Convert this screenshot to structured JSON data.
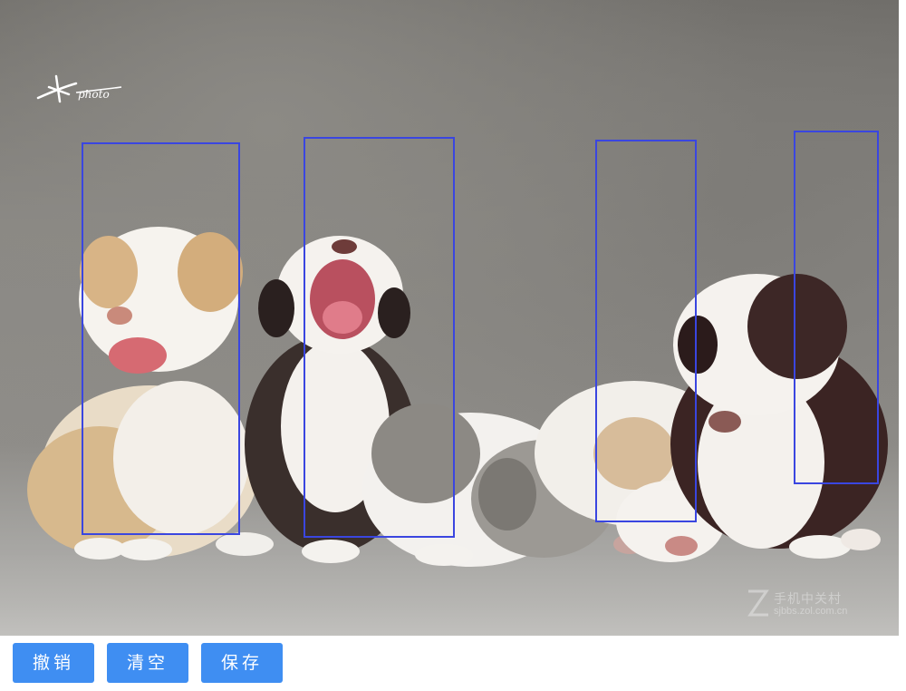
{
  "image": {
    "description_icon": "puppies-photo",
    "signature_icon": "photo-signature-logo",
    "watermark": {
      "line1": "手机中关村",
      "line2": "sjbbs.zol.com.cn"
    }
  },
  "annotations": {
    "box_color": "#3a46e0",
    "count": 4
  },
  "toolbar": {
    "undo_label": "撤销",
    "clear_label": "清空",
    "save_label": "保存",
    "button_color": "#3f8ef2"
  }
}
